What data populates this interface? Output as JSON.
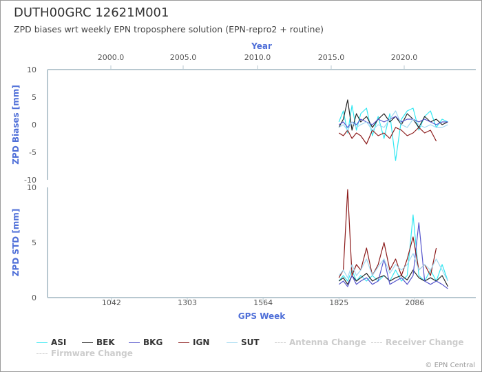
{
  "title": "DUTH00GRC 12621M001",
  "subtitle": "ZPD biases wrt weekly EPN troposphere solution (EPN-repro2 + routine)",
  "credits": "© EPN Central",
  "colors": {
    "axis_title": "#4f6fd8",
    "axis_line": "#b8c8d0"
  },
  "chart_data": {
    "type": "line",
    "x_axis_top": {
      "title": "Year",
      "ticks": [
        "2000.0",
        "2005.0",
        "2010.0",
        "2015.0",
        "2020.0"
      ]
    },
    "x_axis_bottom": {
      "title": "GPS Week",
      "ticks": [
        "1042",
        "1303",
        "1564",
        "1825",
        "2086"
      ],
      "range": [
        822,
        2296
      ]
    },
    "panels": [
      {
        "name": "bias",
        "ylabel": "ZPD Biases [mm]",
        "ylim": [
          -10,
          10
        ],
        "yticks": [
          "10",
          "5",
          "0",
          "-5",
          "-10"
        ],
        "series": [
          {
            "name": "ASI",
            "color": "#33e8f2",
            "x": [
              1825,
              1840,
              1855,
              1870,
              1885,
              1900,
              1920,
              1940,
              1960,
              1980,
              2000,
              2020,
              2040,
              2060,
              2080,
              2100,
              2120,
              2140,
              2160,
              2180,
              2200
            ],
            "y": [
              0.5,
              2.5,
              -1.5,
              3.5,
              -1.0,
              2.0,
              3.0,
              -2.0,
              1.5,
              -2.5,
              2.0,
              -6.5,
              1.0,
              2.5,
              3.0,
              -1.0,
              1.5,
              2.5,
              -0.5,
              1.0,
              0.5
            ]
          },
          {
            "name": "BEK",
            "color": "#222222",
            "x": [
              1825,
              1840,
              1855,
              1870,
              1885,
              1900,
              1920,
              1940,
              1960,
              1980,
              2000,
              2020,
              2040,
              2060,
              2080,
              2100,
              2120,
              2140,
              2160,
              2180,
              2200
            ],
            "y": [
              -0.5,
              1.0,
              4.5,
              -1.0,
              2.0,
              0.5,
              1.5,
              -0.5,
              1.0,
              2.0,
              0.5,
              1.5,
              0.0,
              2.0,
              1.0,
              -0.5,
              1.5,
              0.5,
              1.0,
              0.0,
              0.5
            ]
          },
          {
            "name": "BKG",
            "color": "#5555cc",
            "x": [
              1825,
              1840,
              1855,
              1870,
              1885,
              1900,
              1920,
              1940,
              1960,
              1980,
              2000,
              2020,
              2040,
              2060,
              2080,
              2100,
              2120,
              2140,
              2160,
              2180,
              2200
            ],
            "y": [
              0.0,
              0.5,
              -0.5,
              0.5,
              0.0,
              1.0,
              0.5,
              0.0,
              1.0,
              0.5,
              1.0,
              1.5,
              0.5,
              1.0,
              1.0,
              0.5,
              1.0,
              0.5,
              0.0,
              0.5,
              0.5
            ]
          },
          {
            "name": "IGN",
            "color": "#8b1a1a",
            "x": [
              1825,
              1840,
              1855,
              1870,
              1885,
              1900,
              1920,
              1940,
              1960,
              1980,
              2000,
              2020,
              2040,
              2060,
              2080,
              2100,
              2120,
              2140,
              2160
            ],
            "y": [
              -1.5,
              -2.0,
              -1.0,
              -2.5,
              -1.5,
              -2.0,
              -3.5,
              -1.0,
              -2.0,
              -1.5,
              -2.5,
              -0.5,
              -1.0,
              -2.0,
              -1.5,
              -0.5,
              -1.5,
              -1.0,
              -3.0
            ]
          },
          {
            "name": "SUT",
            "color": "#a0d8f0",
            "x": [
              1825,
              1840,
              1855,
              1870,
              1885,
              1900,
              1920,
              1940,
              1960,
              1980,
              2000,
              2020,
              2040,
              2060,
              2080,
              2100,
              2120,
              2140,
              2160,
              2180,
              2200
            ],
            "y": [
              -0.5,
              0.0,
              -1.0,
              0.5,
              -0.5,
              0.0,
              0.5,
              -1.0,
              0.0,
              -0.5,
              1.0,
              2.5,
              0.0,
              -0.5,
              1.0,
              0.0,
              -0.5,
              0.0,
              -0.5,
              -0.5,
              0.0
            ]
          }
        ]
      },
      {
        "name": "std",
        "ylabel": "ZPD STD [mm]",
        "ylim": [
          0,
          10
        ],
        "yticks": [
          "10",
          "5",
          "0"
        ],
        "series": [
          {
            "name": "ASI",
            "color": "#33e8f2",
            "x": [
              1825,
              1840,
              1855,
              1870,
              1885,
              1900,
              1920,
              1940,
              1960,
              1980,
              2000,
              2020,
              2040,
              2060,
              2080,
              2100,
              2120,
              2140,
              2160,
              2180,
              2200
            ],
            "y": [
              1.5,
              2.0,
              1.5,
              2.5,
              1.5,
              2.0,
              1.5,
              2.0,
              1.5,
              2.0,
              1.5,
              2.5,
              1.5,
              2.0,
              7.5,
              2.0,
              1.5,
              2.5,
              1.5,
              3.0,
              1.5
            ]
          },
          {
            "name": "BEK",
            "color": "#222222",
            "x": [
              1825,
              1840,
              1855,
              1870,
              1885,
              1900,
              1920,
              1940,
              1960,
              1980,
              2000,
              2020,
              2040,
              2060,
              2080,
              2100,
              2120,
              2140,
              2160,
              2180,
              2200
            ],
            "y": [
              1.5,
              1.8,
              1.2,
              2.0,
              1.5,
              1.8,
              2.2,
              1.5,
              1.8,
              2.0,
              1.5,
              1.8,
              2.0,
              1.6,
              2.5,
              1.8,
              1.5,
              1.8,
              1.5,
              2.0,
              1.0
            ]
          },
          {
            "name": "BKG",
            "color": "#5555cc",
            "x": [
              1825,
              1840,
              1855,
              1870,
              1885,
              1900,
              1920,
              1940,
              1960,
              1980,
              2000,
              2020,
              2040,
              2060,
              2080,
              2100,
              2120,
              2140,
              2160,
              2180,
              2200
            ],
            "y": [
              1.2,
              1.5,
              1.0,
              2.0,
              1.2,
              1.5,
              1.8,
              1.2,
              1.5,
              3.5,
              1.2,
              1.5,
              1.8,
              1.2,
              2.0,
              6.8,
              1.5,
              1.2,
              1.5,
              1.2,
              0.8
            ]
          },
          {
            "name": "IGN",
            "color": "#8b1a1a",
            "x": [
              1825,
              1840,
              1855,
              1870,
              1885,
              1900,
              1920,
              1940,
              1960,
              1980,
              2000,
              2020,
              2040,
              2060,
              2080,
              2100,
              2120,
              2140,
              2160
            ],
            "y": [
              1.8,
              2.5,
              9.8,
              2.0,
              3.0,
              2.5,
              4.5,
              2.0,
              3.0,
              5.0,
              2.5,
              3.5,
              2.0,
              3.5,
              5.5,
              2.5,
              3.0,
              2.0,
              4.5
            ]
          },
          {
            "name": "SUT",
            "color": "#a0d8f0",
            "x": [
              1825,
              1840,
              1855,
              1870,
              1885,
              1900,
              1920,
              1940,
              1960,
              1980,
              2000,
              2020,
              2040,
              2060,
              2080,
              2100,
              2120,
              2140,
              2160,
              2180,
              2200
            ],
            "y": [
              2.0,
              2.5,
              1.8,
              3.0,
              2.0,
              2.5,
              3.5,
              2.0,
              2.8,
              3.5,
              2.2,
              3.0,
              2.5,
              3.0,
              4.0,
              2.5,
              3.0,
              2.5,
              3.5,
              2.5,
              1.5
            ]
          }
        ]
      }
    ],
    "legend": {
      "placement": "bottom",
      "items": [
        {
          "label": "ASI",
          "color": "#33e8f2",
          "style": "solid"
        },
        {
          "label": "BEK",
          "color": "#222222",
          "style": "solid"
        },
        {
          "label": "BKG",
          "color": "#5555cc",
          "style": "solid"
        },
        {
          "label": "IGN",
          "color": "#8b1a1a",
          "style": "solid"
        },
        {
          "label": "SUT",
          "color": "#a0d8f0",
          "style": "solid"
        },
        {
          "label": "Antenna Change",
          "color": "#cccccc",
          "style": "dashed"
        },
        {
          "label": "Receiver Change",
          "color": "#cccccc",
          "style": "dashed"
        },
        {
          "label": "Firmware Change",
          "color": "#cccccc",
          "style": "dashed"
        }
      ]
    }
  }
}
